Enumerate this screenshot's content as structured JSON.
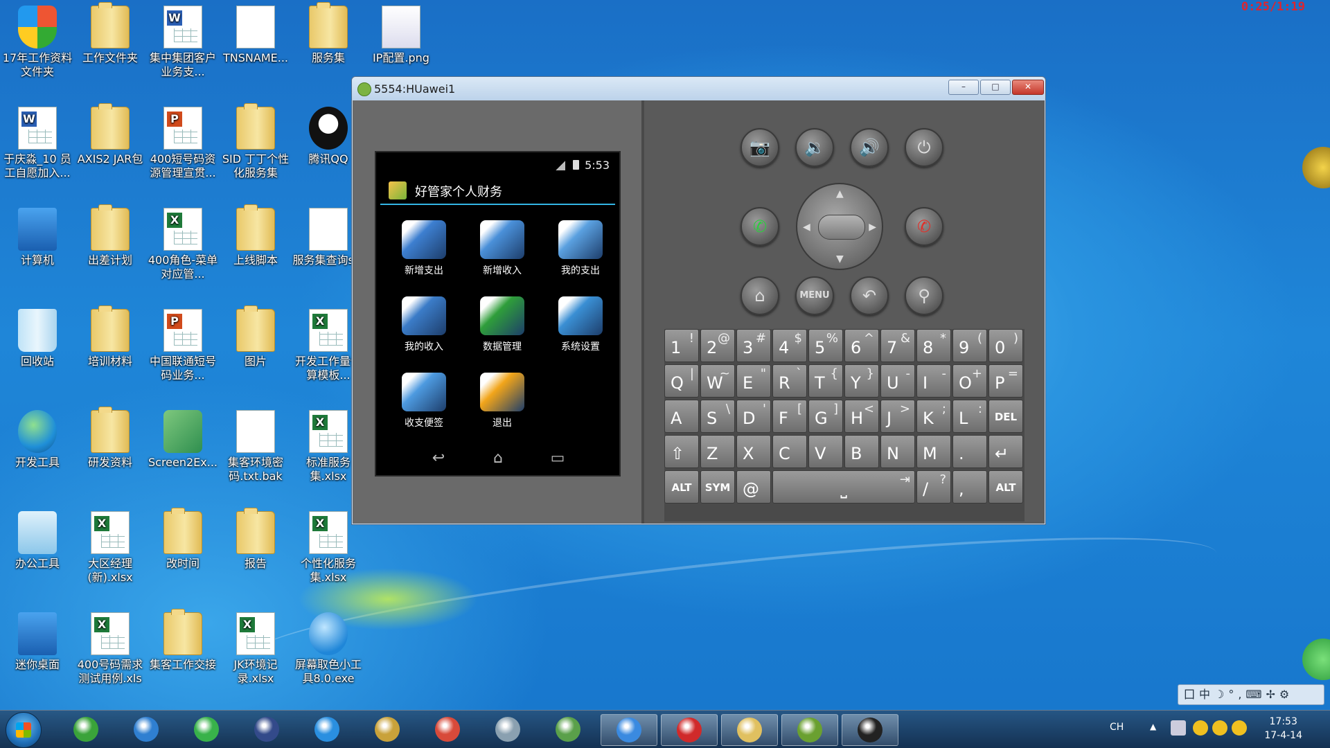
{
  "recording_time": "0:25/1:19",
  "desktop_icons": [
    {
      "label": "17年工作资料文件夹",
      "type": "shield"
    },
    {
      "label": "工作文件夹",
      "type": "folder"
    },
    {
      "label": "集中集团客户业务支...",
      "type": "word"
    },
    {
      "label": "TNSNAME...",
      "type": "doc"
    },
    {
      "label": "服务集",
      "type": "folder"
    },
    {
      "label": "IP配置.png",
      "type": "image"
    },
    {
      "label": "于庆淼_10 员工自愿加入...",
      "type": "word"
    },
    {
      "label": "AXIS2 JAR包",
      "type": "folder"
    },
    {
      "label": "400短号码资源管理宣贯...",
      "type": "ppt"
    },
    {
      "label": "SID 丁丁个性化服务集",
      "type": "folder"
    },
    {
      "label": "腾讯QQ",
      "type": "qq"
    },
    {
      "label": "计算机",
      "type": "computer"
    },
    {
      "label": "出差计划",
      "type": "folder"
    },
    {
      "label": "400角色-菜单对应管...",
      "type": "excel"
    },
    {
      "label": "上线脚本",
      "type": "folder"
    },
    {
      "label": "服务集查询sql",
      "type": "doc"
    },
    {
      "label": "回收站",
      "type": "recycle"
    },
    {
      "label": "培训材料",
      "type": "folder"
    },
    {
      "label": "中国联通短号码业务...",
      "type": "ppt"
    },
    {
      "label": "图片",
      "type": "folder"
    },
    {
      "label": "开发工作量估算模板...",
      "type": "excel"
    },
    {
      "label": "开发工具",
      "type": "globe"
    },
    {
      "label": "研发资料",
      "type": "folder"
    },
    {
      "label": "Screen2Ex...",
      "type": "box"
    },
    {
      "label": "集客环境密码.txt.bak",
      "type": "doc"
    },
    {
      "label": "标准服务集.xlsx",
      "type": "excel"
    },
    {
      "label": "办公工具",
      "type": "tools"
    },
    {
      "label": "大区经理(新).xlsx",
      "type": "excel"
    },
    {
      "label": "改时间",
      "type": "folder"
    },
    {
      "label": "报告",
      "type": "folder"
    },
    {
      "label": "个性化服务集.xlsx",
      "type": "excel"
    },
    {
      "label": "迷你桌面",
      "type": "computer"
    },
    {
      "label": "400号码需求测试用例.xls",
      "type": "excel"
    },
    {
      "label": "集客工作交接",
      "type": "folder"
    },
    {
      "label": "JK环境记录.xlsx",
      "type": "excel"
    },
    {
      "label": "屏幕取色小工具8.0.exe",
      "type": "bubble"
    }
  ],
  "emulator": {
    "title": "5554:HUawei1",
    "controls": {
      "minimize": "–",
      "maximize": "□",
      "close": "✕"
    },
    "status_time": "5:53",
    "app_title": "好管家个人财务",
    "tiles": [
      {
        "label": "新增支出",
        "color": "#3d7fd0"
      },
      {
        "label": "新增收入",
        "color": "#4a90d9"
      },
      {
        "label": "我的支出",
        "color": "#5aa0e0"
      },
      {
        "label": "我的收入",
        "color": "#3b7cc8"
      },
      {
        "label": "数据管理",
        "color": "#2f9e3a"
      },
      {
        "label": "系统设置",
        "color": "#3a8fd4"
      },
      {
        "label": "收支便签",
        "color": "#4d9ae0"
      },
      {
        "label": "退出",
        "color": "#f2a51a"
      }
    ],
    "nav_buttons": {
      "back": "↩",
      "home": "⌂",
      "recents": "▭"
    },
    "hardware_buttons": {
      "camera": "📷",
      "vol_down": "🔉",
      "vol_up": "🔊",
      "power": "⏻",
      "call": "✆",
      "end_call": "✆",
      "home": "⌂",
      "menu": "MENU",
      "back": "↶",
      "search": "⚲"
    },
    "keyboard": [
      [
        {
          "m": "1",
          "a": "!"
        },
        {
          "m": "2",
          "a": "@"
        },
        {
          "m": "3",
          "a": "#"
        },
        {
          "m": "4",
          "a": "$"
        },
        {
          "m": "5",
          "a": "%"
        },
        {
          "m": "6",
          "a": "^"
        },
        {
          "m": "7",
          "a": "&"
        },
        {
          "m": "8",
          "a": "*"
        },
        {
          "m": "9",
          "a": "("
        },
        {
          "m": "0",
          "a": ")"
        }
      ],
      [
        {
          "m": "Q",
          "a": "|"
        },
        {
          "m": "W",
          "a": "~"
        },
        {
          "m": "E",
          "a": "\""
        },
        {
          "m": "R",
          "a": "`"
        },
        {
          "m": "T",
          "a": "{"
        },
        {
          "m": "Y",
          "a": "}"
        },
        {
          "m": "U",
          "a": "-"
        },
        {
          "m": "I",
          "a": "-"
        },
        {
          "m": "O",
          "a": "+"
        },
        {
          "m": "P",
          "a": "="
        }
      ],
      [
        {
          "m": "A",
          "a": ""
        },
        {
          "m": "S",
          "a": "\\"
        },
        {
          "m": "D",
          "a": "'"
        },
        {
          "m": "F",
          "a": "["
        },
        {
          "m": "G",
          "a": "]"
        },
        {
          "m": "H",
          "a": "<"
        },
        {
          "m": "J",
          "a": ">"
        },
        {
          "m": "K",
          "a": ";"
        },
        {
          "m": "L",
          "a": ":"
        },
        {
          "m": "DEL",
          "a": ""
        }
      ],
      [
        {
          "m": "⇧",
          "a": ""
        },
        {
          "m": "Z",
          "a": ""
        },
        {
          "m": "X",
          "a": ""
        },
        {
          "m": "C",
          "a": ""
        },
        {
          "m": "V",
          "a": ""
        },
        {
          "m": "B",
          "a": ""
        },
        {
          "m": "N",
          "a": ""
        },
        {
          "m": "M",
          "a": ""
        },
        {
          "m": ".",
          "a": ""
        },
        {
          "m": "↵",
          "a": ""
        }
      ],
      [
        {
          "m": "ALT",
          "a": ""
        },
        {
          "m": "SYM",
          "a": ""
        },
        {
          "m": "@",
          "a": ""
        },
        {
          "m": "⎵",
          "a": "⇥"
        },
        {
          "m": "/",
          "a": "?"
        },
        {
          "m": ",",
          "a": ""
        },
        {
          "m": "ALT",
          "a": ""
        }
      ]
    ]
  },
  "taskbar": {
    "apps": [
      {
        "name": "paw-app",
        "color": "#3aa33a"
      },
      {
        "name": "cloud-app",
        "color": "#2f7fd1"
      },
      {
        "name": "browser-360",
        "color": "#38b24a"
      },
      {
        "name": "pen-app",
        "color": "#334a8a"
      },
      {
        "name": "ie-app",
        "color": "#2a8fe0"
      },
      {
        "name": "tools-app",
        "color": "#c9a23a"
      },
      {
        "name": "paint-app",
        "color": "#d84a3a"
      },
      {
        "name": "calc-app",
        "color": "#8aa0b0"
      },
      {
        "name": "chart-app",
        "color": "#5aa04a"
      },
      {
        "name": "feather-app",
        "color": "#3a8ae0"
      },
      {
        "name": "red-app",
        "color": "#d02a2a"
      },
      {
        "name": "explorer-app",
        "color": "#e0c060"
      },
      {
        "name": "braces-app",
        "color": "#6aa030"
      },
      {
        "name": "android-app",
        "color": "#222"
      }
    ],
    "lang": "CH",
    "time": "17:53",
    "date": "17-4-14"
  },
  "ime_bar": "囗中☽°,⌨✢⚙"
}
